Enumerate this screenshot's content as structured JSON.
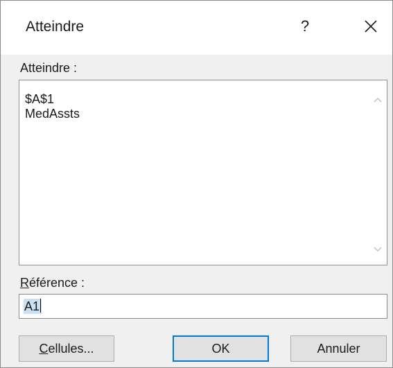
{
  "dialog": {
    "title": "Atteindre",
    "help_label": "?"
  },
  "goto_list": {
    "label": "Atteindre :",
    "items": [
      "$A$1",
      "MedAssts"
    ]
  },
  "reference": {
    "label_access": "R",
    "label_rest": "éférence :",
    "value": "A1"
  },
  "buttons": {
    "cells_access": "C",
    "cells_rest": "ellules...",
    "ok": "OK",
    "cancel": "Annuler"
  },
  "colors": {
    "accent": "#0078d7",
    "selection": "#cce0f5",
    "dialog_bg": "#f0f0f0"
  }
}
